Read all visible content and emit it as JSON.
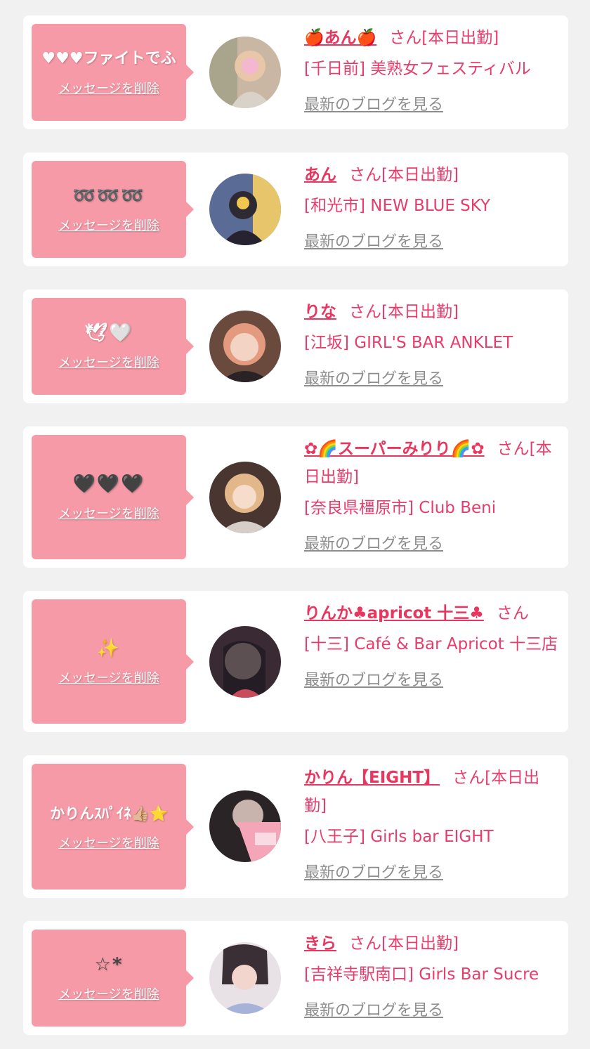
{
  "cards": [
    {
      "bubble_text": "♥♥♥ファイトでふ",
      "delete_label": "メッセージを削除",
      "name": "🍎あん🍎",
      "name_suffix": "さん[本日出勤]",
      "shop": "[千日前] 美熟女フェスティバル",
      "blog_label": "最新のブログを見る"
    },
    {
      "bubble_text": "➿➿➿",
      "delete_label": "メッセージを削除",
      "name": "あん",
      "name_suffix": "さん[本日出勤]",
      "shop": "[和光市] NEW BLUE SKY",
      "blog_label": "最新のブログを見る"
    },
    {
      "bubble_text": "🕊🤍",
      "delete_label": "メッセージを削除",
      "name": "りな",
      "name_suffix": "さん[本日出勤]",
      "shop": "[江坂] GIRL'S BAR ANKLET",
      "blog_label": "最新のブログを見る"
    },
    {
      "bubble_text": "🖤🖤🖤",
      "delete_label": "メッセージを削除",
      "name": "✿🌈スーパーみりり🌈✿",
      "name_suffix": "さん[本日出勤]",
      "shop": "[奈良県橿原市] Club Beni",
      "blog_label": "最新のブログを見る"
    },
    {
      "bubble_text": "✨",
      "delete_label": "メッセージを削除",
      "name": "りんか♣apricot 十三♣",
      "name_suffix": "さん",
      "shop": "[十三] Café & Bar Apricot 十三店",
      "blog_label": "最新のブログを見る"
    },
    {
      "bubble_text": "かりんｽﾊﾟｲﾈ👍🏼⭐",
      "delete_label": "メッセージを削除",
      "name": "かりん【EIGHT】",
      "name_suffix": "さん[本日出勤]",
      "shop": "[八王子] Girls bar EIGHT",
      "blog_label": "最新のブログを見る"
    },
    {
      "bubble_text": "☆*",
      "delete_label": "メッセージを削除",
      "name": "きら",
      "name_suffix": "さん[本日出勤]",
      "shop": "[吉祥寺駅南口] Girls Bar Sucre",
      "blog_label": "最新のブログを見る"
    }
  ]
}
